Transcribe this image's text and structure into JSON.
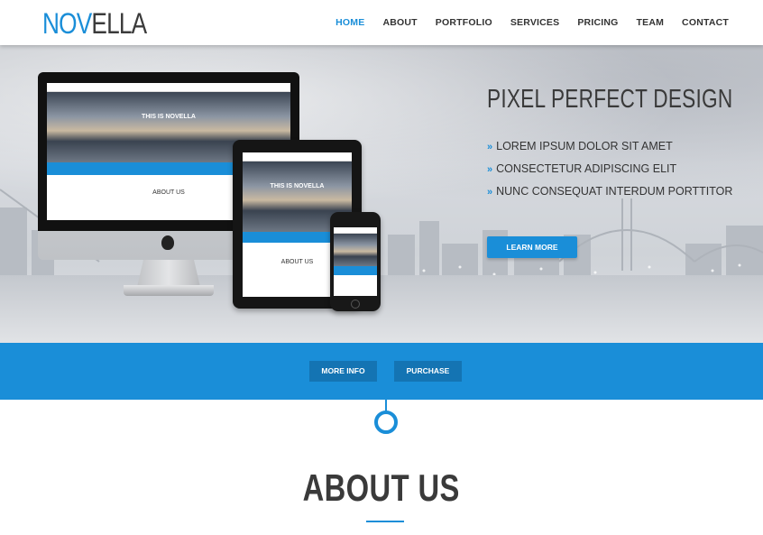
{
  "brand": {
    "prefix": "NOV",
    "suffix": "ELLA",
    "accent": "#1a8ed8"
  },
  "nav": {
    "items": [
      {
        "label": "HOME",
        "active": true
      },
      {
        "label": "ABOUT"
      },
      {
        "label": "PORTFOLIO"
      },
      {
        "label": "SERVICES"
      },
      {
        "label": "PRICING"
      },
      {
        "label": "TEAM"
      },
      {
        "label": "CONTACT"
      }
    ]
  },
  "hero": {
    "title": "PIXEL PERFECT DESIGN",
    "features": [
      "LOREM IPSUM DOLOR SIT AMET",
      "CONSECTETUR ADIPISCING ELIT",
      "NUNC CONSEQUAT INTERDUM PORTTITOR"
    ],
    "cta_label": "LEARN MORE",
    "device_tagline": "THIS IS NOVELLA",
    "device_about": "ABOUT US"
  },
  "bar": {
    "more_info": "MORE INFO",
    "purchase": "PURCHASE"
  },
  "about": {
    "title": "ABOUT US"
  }
}
